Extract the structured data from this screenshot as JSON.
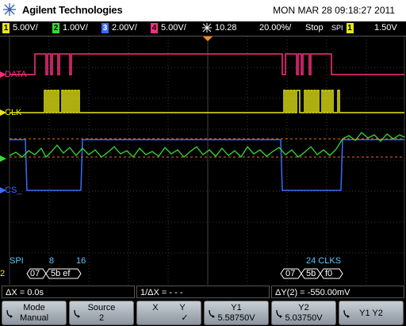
{
  "header": {
    "brand": "Agilent Technologies",
    "datetime": "MON MAR 28 09:18:27 2011"
  },
  "status": {
    "ch1": {
      "num": "1",
      "scale": "5.00V/"
    },
    "ch2": {
      "num": "2",
      "scale": "1.00V/"
    },
    "ch3": {
      "num": "3",
      "scale": "2.00V/"
    },
    "ch4": {
      "num": "4",
      "scale": "5.00V/"
    },
    "delay": "10.28",
    "timebase": "20.00%/",
    "run_state": "Stop",
    "trigger_source": "SPI",
    "trigger_ch": "1",
    "trigger_level": "1.50V"
  },
  "traces": {
    "data_label": "DATA",
    "clk_label": "CLK",
    "cs_label": "CS_",
    "spi_label": "SPI",
    "spi_marker1": "8",
    "spi_marker2": "16",
    "spi_marker3": "24 CLKS",
    "ch_num_left": "2",
    "decode_left": [
      "07",
      "5b ef"
    ],
    "decode_right": [
      "07",
      "5b",
      "f0"
    ]
  },
  "measurements": {
    "dx": "ΔX = 0.0s",
    "inv_dx": "1/ΔX = - - -",
    "dy": "ΔY(2) = -550.00mV"
  },
  "softkeys": {
    "mode_label": "Mode",
    "mode_value": "Manual",
    "source_label": "Source",
    "source_value": "2",
    "xy_x": "X",
    "xy_y": "Y",
    "xy_check": "✓",
    "y1_label": "Y1",
    "y1_value": "5.58750V",
    "y2_label": "Y2",
    "y2_value": "5.03750V",
    "y1y2_label": "Y1 Y2"
  },
  "colors": {
    "ch1": "#e8e815",
    "ch2": "#33dd33",
    "ch3": "#3a6bff",
    "ch4": "#ff2d80",
    "decode": "#5cc9ff"
  }
}
